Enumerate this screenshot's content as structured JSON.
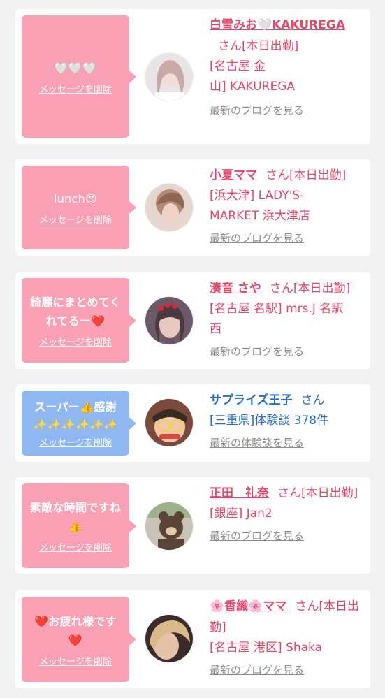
{
  "items": [
    {
      "message": "🤍🤍🤍",
      "delete_label": "メッセージを削除",
      "name": "白雪みお🤍KAKUREGA",
      "name_suffix": "さん[本日出勤]",
      "detail": "[名古屋 金\n山] KAKUREGA",
      "link": "最新のブログを見る",
      "bubble_color": "#f9a0b4",
      "avatar_colors": [
        "#e9e4e6",
        "#c8a9a6"
      ]
    },
    {
      "message": "lunch😍",
      "delete_label": "メッセージを削除",
      "name": "小夏ママ",
      "name_suffix": "さん[本日出勤]",
      "detail": "[浜大津] LADY'S-\nMARKET 浜大津店",
      "link": "最新のブログを見る",
      "bubble_color": "#f9a0b4",
      "avatar_colors": [
        "#b48a76",
        "#e7d6cd"
      ]
    },
    {
      "message": "綺麗にまとめてく\nれてるー❤️",
      "delete_label": "メッセージを削除",
      "name": "湊音 さや",
      "name_suffix": "さん[本日出勤]",
      "detail": "[名古屋 名駅] mrs.J 名駅\n西",
      "link": "最新のブログを見る",
      "bubble_color": "#f9a0b4",
      "avatar_colors": [
        "#6c5a6a",
        "#e8c9c0"
      ]
    },
    {
      "message": "スーパー👍感謝\n✨✨✨✨✨✨",
      "delete_label": "メッセージを削除",
      "name": "サプライズ王子",
      "name_suffix": "さん",
      "detail": "[三重県]体験談 378件",
      "link": "最新の体験談を見る",
      "bubble_color": "#8fb7f2",
      "avatar_colors": [
        "#d84a3a",
        "#f2d15a"
      ]
    },
    {
      "message": "素敵な時間ですね\n👍",
      "delete_label": "メッセージを削除",
      "name": "正田　礼奈",
      "name_suffix": "さん[本日出勤]",
      "detail": "[銀座] Jan2",
      "link": "最新のブログを見る",
      "bubble_color": "#f9a0b4",
      "avatar_colors": [
        "#5b4335",
        "#c9c2b8"
      ]
    },
    {
      "message": "❤️お疲れ様です\n❤️",
      "delete_label": "メッセージを削除",
      "name": "🌸香織🌸ママ",
      "name_suffix": "さん[本日出勤]",
      "detail": "[名古屋 港区] Shaka",
      "link": "最新のブログを見る",
      "bubble_color": "#f9a0b4",
      "avatar_colors": [
        "#3a2c2a",
        "#d9b98a"
      ]
    }
  ]
}
